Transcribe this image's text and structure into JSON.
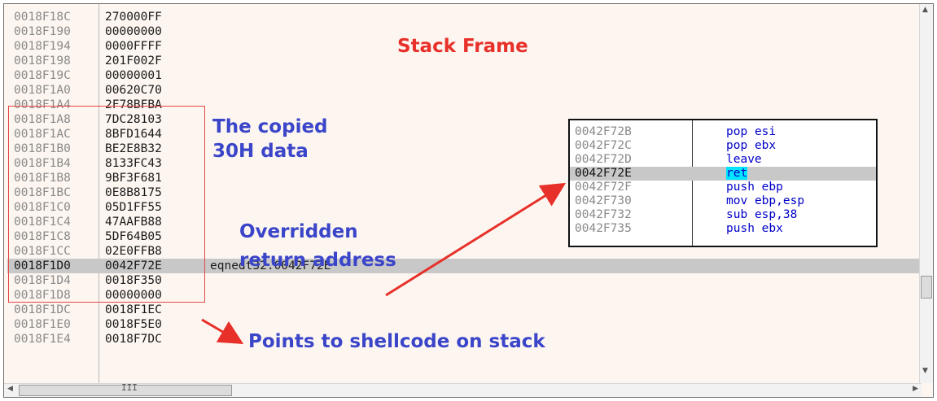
{
  "stack": {
    "rows": [
      {
        "addr": "0018F18C",
        "value": "270000FF",
        "comment": ""
      },
      {
        "addr": "0018F190",
        "value": "00000000",
        "comment": ""
      },
      {
        "addr": "0018F194",
        "value": "0000FFFF",
        "comment": ""
      },
      {
        "addr": "0018F198",
        "value": "201F002F",
        "comment": ""
      },
      {
        "addr": "0018F19C",
        "value": "00000001",
        "comment": ""
      },
      {
        "addr": "0018F1A0",
        "value": "00620C70",
        "comment": ""
      },
      {
        "addr": "0018F1A4",
        "value": "2F78BFBA",
        "comment": ""
      },
      {
        "addr": "0018F1A8",
        "value": "7DC28103",
        "comment": ""
      },
      {
        "addr": "0018F1AC",
        "value": "8BFD1644",
        "comment": ""
      },
      {
        "addr": "0018F1B0",
        "value": "BE2E8B32",
        "comment": ""
      },
      {
        "addr": "0018F1B4",
        "value": "8133FC43",
        "comment": ""
      },
      {
        "addr": "0018F1B8",
        "value": "9BF3F681",
        "comment": ""
      },
      {
        "addr": "0018F1BC",
        "value": "0E8B8175",
        "comment": ""
      },
      {
        "addr": "0018F1C0",
        "value": "05D1FF55",
        "comment": ""
      },
      {
        "addr": "0018F1C4",
        "value": "47AAFB88",
        "comment": ""
      },
      {
        "addr": "0018F1C8",
        "value": "5DF64B05",
        "comment": ""
      },
      {
        "addr": "0018F1CC",
        "value": "02E0FFB8",
        "comment": ""
      },
      {
        "addr": "0018F1D0",
        "value": "0042F72E",
        "comment": "eqnedt32.0042F72E"
      },
      {
        "addr": "0018F1D4",
        "value": "0018F350",
        "comment": ""
      },
      {
        "addr": "0018F1D8",
        "value": "00000000",
        "comment": ""
      },
      {
        "addr": "0018F1DC",
        "value": "0018F1EC",
        "comment": ""
      },
      {
        "addr": "0018F1E0",
        "value": "0018F5E0",
        "comment": ""
      },
      {
        "addr": "0018F1E4",
        "value": "0018F7DC",
        "comment": ""
      }
    ]
  },
  "annotations": {
    "title": "Stack Frame",
    "copied_line1": "The copied",
    "copied_line2": "30H data",
    "override_line1": "Overridden",
    "override_line2": "return address",
    "shellcode": "Points to shellcode on stack"
  },
  "disasm": {
    "rows": [
      {
        "addr": "0042F72B",
        "mnemonic": "pop",
        "operands": "esi"
      },
      {
        "addr": "0042F72C",
        "mnemonic": "pop",
        "operands": "ebx"
      },
      {
        "addr": "0042F72D",
        "mnemonic": "leave",
        "operands": ""
      },
      {
        "addr": "0042F72E",
        "mnemonic": "ret",
        "operands": ""
      },
      {
        "addr": "0042F72F",
        "mnemonic": "push",
        "operands": "ebp"
      },
      {
        "addr": "0042F730",
        "mnemonic": "mov",
        "operands": "ebp,esp"
      },
      {
        "addr": "0042F732",
        "mnemonic": "sub",
        "operands": "esp,38"
      },
      {
        "addr": "0042F735",
        "mnemonic": "push",
        "operands": "ebx"
      }
    ]
  },
  "scrollbar": {
    "grip": "III"
  },
  "colors": {
    "annotation_red": "#e8302a",
    "annotation_blue": "#3a45c9",
    "highlight_row": "#c8c8c8",
    "ret_highlight": "#00e5ff"
  }
}
